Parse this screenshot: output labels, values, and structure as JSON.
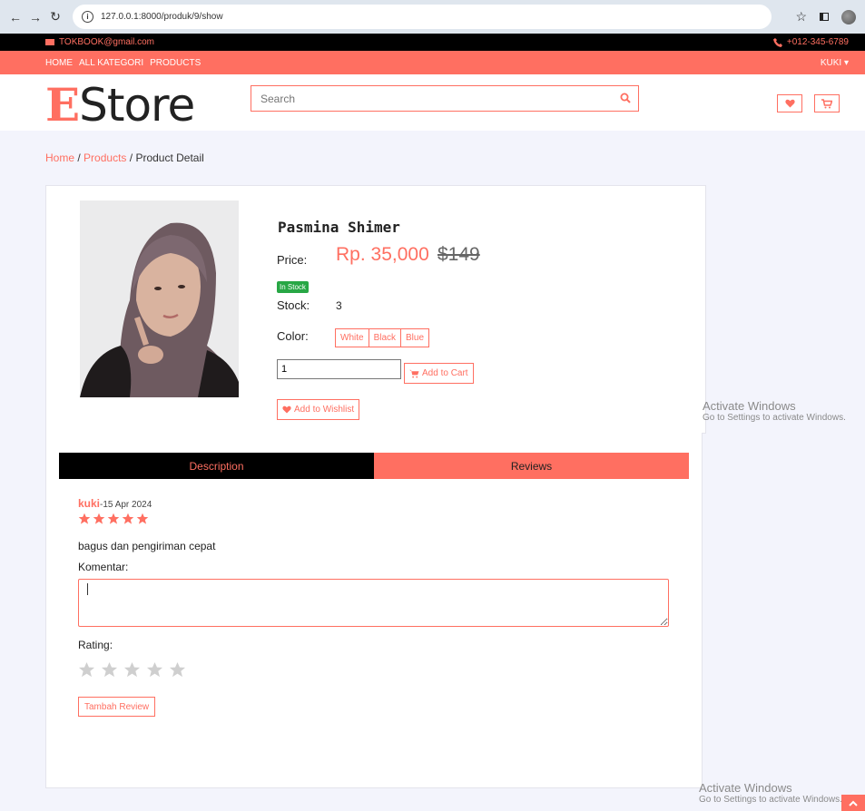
{
  "browser": {
    "url": "127.0.0.1:8000/produk/9/show"
  },
  "topbar": {
    "email": "TOKBOOK@gmail.com",
    "phone": "+012-345-6789"
  },
  "nav": {
    "links": [
      "HOME",
      "ALL KATEGORI",
      "PRODUCTS"
    ],
    "user": "KUKI ▾"
  },
  "header": {
    "logo_first": "E",
    "logo_rest": "Store",
    "search_placeholder": "Search"
  },
  "breadcrumb": {
    "home": "Home",
    "sep1": "/",
    "products": "Products",
    "sep2": "/",
    "current": "Product Detail"
  },
  "product": {
    "name": "Pasmina Shimer",
    "price_label": "Price:",
    "price": "Rp. 35,000",
    "old_price": "$149",
    "badge": "In Stock",
    "stock_label": "Stock:",
    "stock": "3",
    "color_label": "Color:",
    "colors": [
      "White",
      "Black",
      "Blue"
    ],
    "quantity": "1",
    "add_to_cart": "Add to Cart",
    "add_to_wishlist": "Add to Wishlist"
  },
  "tabs": {
    "description": "Description",
    "reviews": "Reviews"
  },
  "review": {
    "user": "kuki",
    "date": "-15 Apr 2024",
    "rating": 5,
    "text": "bagus dan pengiriman cepat"
  },
  "form": {
    "comment_label": "Komentar:",
    "comment_value": "",
    "rating_label": "Rating:",
    "rating_value": 0,
    "submit": "Tambah Review"
  },
  "watermark": {
    "title": "Activate Windows",
    "subtitle": "Go to Settings to activate Windows."
  },
  "colors": {
    "accent": "#ff6f61",
    "black": "#000000",
    "success": "#28a745",
    "page_bg": "#f3f4fc"
  }
}
